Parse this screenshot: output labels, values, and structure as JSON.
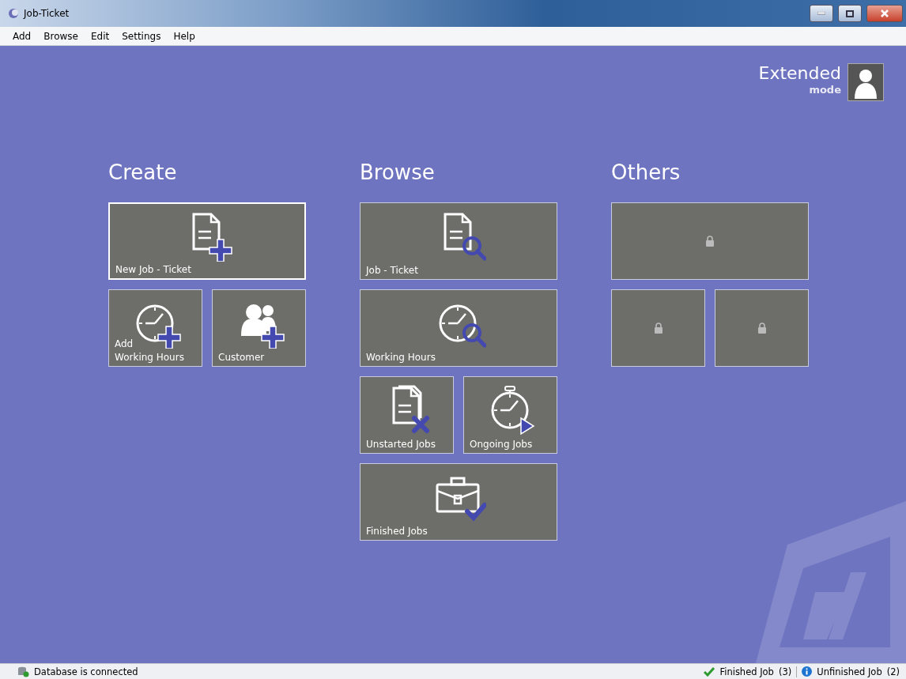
{
  "window": {
    "title": "Job-Ticket"
  },
  "menu": [
    "Add",
    "Browse",
    "Edit",
    "Settings",
    "Help"
  ],
  "mode": {
    "title": "Extended",
    "subtitle": "mode"
  },
  "sections": [
    {
      "heading": "Create",
      "rows": [
        [
          {
            "label": "New Job - Ticket",
            "kind": "doc-plus",
            "selected": true,
            "locked": false
          }
        ],
        [
          {
            "label": "Add\nWorking Hours",
            "kind": "clock-plus",
            "selected": false,
            "locked": false
          },
          {
            "label": "Customer",
            "kind": "users-plus",
            "selected": false,
            "locked": false
          }
        ]
      ]
    },
    {
      "heading": "Browse",
      "rows": [
        [
          {
            "label": "Job - Ticket",
            "kind": "doc-search",
            "selected": false,
            "locked": false
          }
        ],
        [
          {
            "label": "Working Hours",
            "kind": "clock-search",
            "selected": false,
            "locked": false
          }
        ],
        [
          {
            "label": "Unstarted Jobs",
            "kind": "docs-x",
            "selected": false,
            "locked": false
          },
          {
            "label": "Ongoing Jobs",
            "kind": "stopwatch-play",
            "selected": false,
            "locked": false
          }
        ],
        [
          {
            "label": "Finished Jobs",
            "kind": "case-check",
            "selected": false,
            "locked": false
          }
        ]
      ]
    },
    {
      "heading": "Others",
      "rows": [
        [
          {
            "selected": false,
            "locked": true
          }
        ],
        [
          {
            "selected": false,
            "locked": true
          },
          {
            "selected": false,
            "locked": true
          }
        ]
      ]
    }
  ],
  "status_bar": {
    "left": "Database is connected",
    "right": [
      {
        "kind": "ok",
        "label": "Finished Job",
        "count": "(3)"
      },
      {
        "kind": "info",
        "label": "Unfinished Job",
        "count": "(2)"
      }
    ]
  }
}
